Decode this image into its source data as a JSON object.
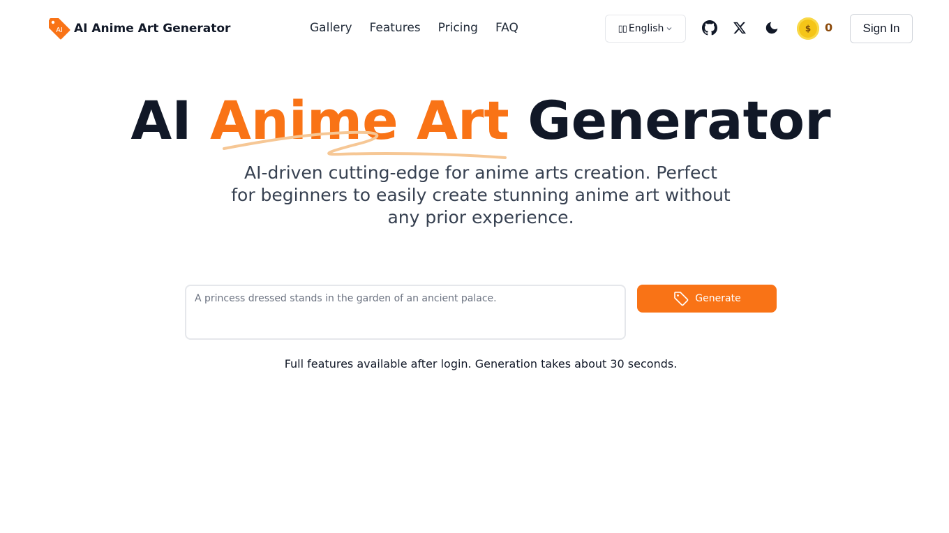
{
  "header": {
    "logo_badge": "AI",
    "logo_text": "AI Anime Art Generator",
    "nav": [
      {
        "label": "Gallery"
      },
      {
        "label": "Features"
      },
      {
        "label": "Pricing"
      },
      {
        "label": "FAQ"
      }
    ],
    "language": {
      "flag": "🇺🇸",
      "selected": "English"
    },
    "icons": {
      "github": "github-icon",
      "x": "x-icon",
      "theme": "moon-icon"
    },
    "credits": {
      "symbol": "$",
      "count": "0"
    },
    "sign_in_label": "Sign In"
  },
  "hero": {
    "title_prefix": "AI",
    "title_accent": "Anime Art",
    "title_suffix": "Generator",
    "subtitle": "AI-driven cutting-edge for anime arts creation. Perfect for beginners to easily create stunning anime art without any prior experience."
  },
  "prompt": {
    "placeholder": "A princess dressed stands in the garden of an ancient palace.",
    "value": ""
  },
  "generate_label": "Generate",
  "note": "Full features available after login. Generation takes about 30 seconds.",
  "colors": {
    "accent": "#f97316",
    "text": "#111827",
    "coin": "#f5c518"
  }
}
